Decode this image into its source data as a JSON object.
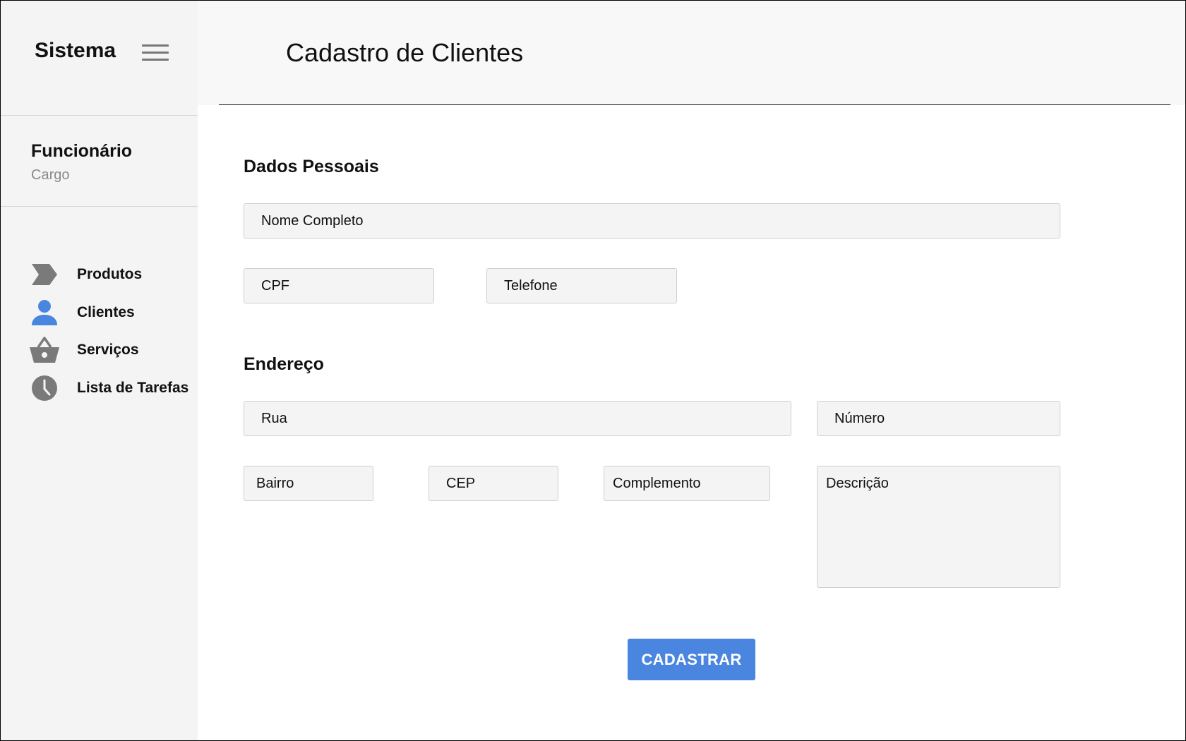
{
  "sidebar": {
    "brand": "Sistema",
    "user": {
      "name": "Funcionário",
      "role": "Cargo"
    },
    "items": [
      {
        "label": "Produtos",
        "icon": "chevron-tag-icon",
        "color": "#7a7a7a"
      },
      {
        "label": "Clientes",
        "icon": "person-icon",
        "color": "#4a86e0"
      },
      {
        "label": "Serviços",
        "icon": "basket-icon",
        "color": "#7a7a7a"
      },
      {
        "label": "Lista de Tarefas",
        "icon": "clock-icon",
        "color": "#7a7a7a"
      }
    ]
  },
  "header": {
    "title": "Cadastro de Clientes"
  },
  "form": {
    "personal": {
      "title": "Dados Pessoais",
      "name_placeholder": "Nome Completo",
      "cpf_placeholder": "CPF",
      "phone_placeholder": "Telefone"
    },
    "address": {
      "title": "Endereço",
      "street_placeholder": "Rua",
      "number_placeholder": "Número",
      "district_placeholder": "Bairro",
      "zip_placeholder": "CEP",
      "complement_placeholder": "Complemento",
      "description_placeholder": "Descrição"
    },
    "submit_label": "CADASTRAR"
  },
  "colors": {
    "accent": "#4a86e0",
    "sidebar_bg": "#f4f4f4",
    "field_bg": "#f4f4f4",
    "icon_gray": "#7a7a7a"
  }
}
